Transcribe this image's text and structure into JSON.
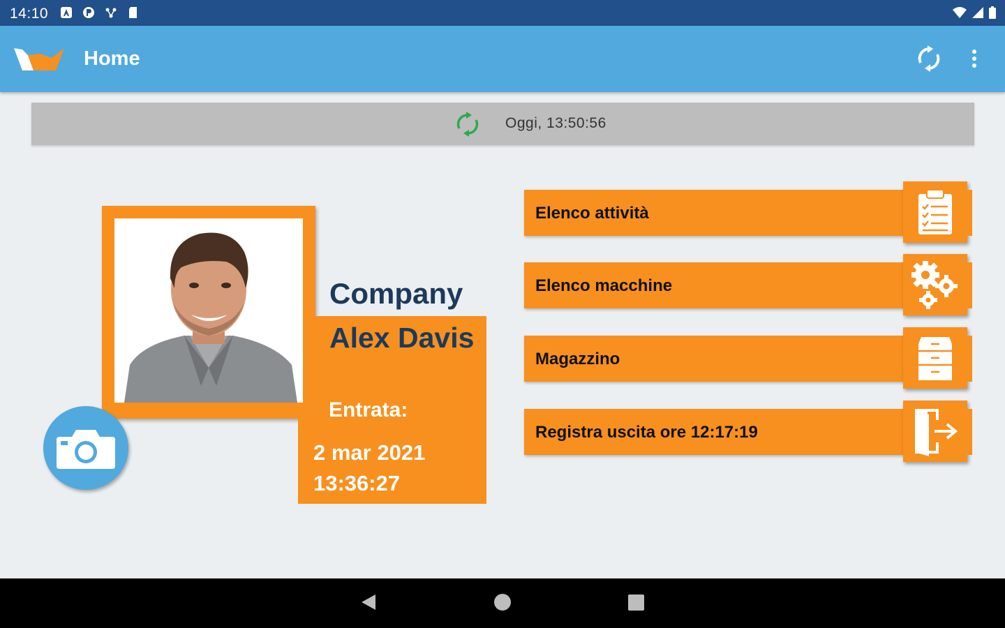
{
  "status_bar": {
    "time": "14:10"
  },
  "app_bar": {
    "title": "Home"
  },
  "sync_strip": {
    "text": "Oggi, 13:50:56"
  },
  "profile": {
    "company": "Company",
    "name": "Alex Davis",
    "entrata_label": "Entrata:",
    "entrata_date": "2 mar 2021",
    "entrata_time": "13:36:27"
  },
  "menu": [
    {
      "label": "Elenco attività",
      "icon": "clipboard-checklist-icon"
    },
    {
      "label": "Elenco macchine",
      "icon": "gears-icon"
    },
    {
      "label": "Magazzino",
      "icon": "filing-cabinet-icon"
    },
    {
      "label": "Registra uscita ore 12:17:19",
      "icon": "exit-door-icon"
    }
  ],
  "colors": {
    "status_bar": "#21508a",
    "app_bar": "#51a9de",
    "accent_orange": "#f7901e",
    "name_text": "#1b3a5c",
    "background": "#eceff1",
    "sync_green": "#2fa84f"
  }
}
